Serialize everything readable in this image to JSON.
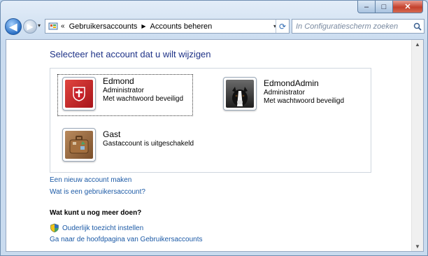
{
  "window": {
    "caption": {
      "minimize": "–",
      "maximize": "□",
      "close": "✕"
    }
  },
  "nav": {
    "back_glyph": "◀",
    "forward_glyph": "▶",
    "history_glyph": "▾",
    "address": {
      "chevron": "«",
      "crumbs": [
        "Gebruikersaccounts",
        "Accounts beheren"
      ],
      "separator": "▶",
      "dropdown_glyph": "▾",
      "refresh_glyph": "⟳"
    },
    "search": {
      "placeholder": "In Configuratiescherm zoeken"
    }
  },
  "main": {
    "title": "Selecteer het account dat u wilt wijzigen",
    "accounts": [
      {
        "name": "Edmond",
        "role": "Administrator",
        "status": "Met wachtwoord beveiligd",
        "picture": "flag-picture-icon",
        "color": "#c8212a"
      },
      {
        "name": "EdmondAdmin",
        "role": "Administrator",
        "status": "Met wachtwoord beveiligd",
        "picture": "dog-picture-icon",
        "color": "#2b2b2b"
      },
      {
        "name": "Gast",
        "role": "Gastaccount is uitgeschakeld",
        "status": "",
        "picture": "suitcase-picture-icon",
        "color": "#9b6a3e"
      }
    ],
    "links": {
      "new_account": "Een nieuw account maken",
      "what_is": "Wat is een gebruikersaccount?"
    },
    "more_heading": "Wat kunt u nog meer doen?",
    "more_links": {
      "parental": "Ouderlijk toezicht instellen",
      "main_page": "Ga naar de hoofdpagina van Gebruikersaccounts"
    }
  },
  "colors": {
    "link": "#1c5aa6",
    "title": "#1e3287"
  }
}
